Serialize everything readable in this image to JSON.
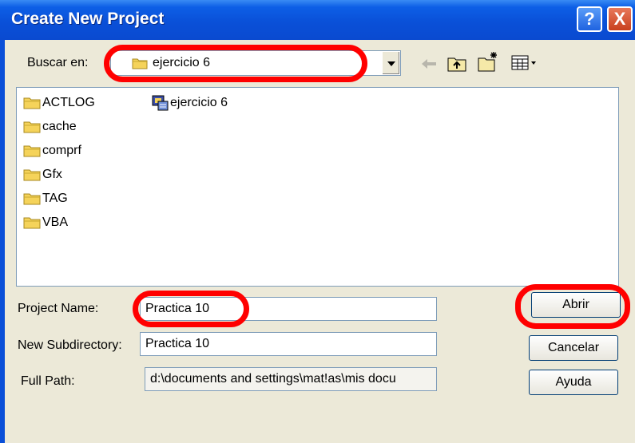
{
  "dialog": {
    "title": "Create New Project",
    "help_glyph": "?",
    "close_glyph": "X"
  },
  "lookin": {
    "label": "Buscar en:",
    "value": "ejercicio 6"
  },
  "toolbar_icons": [
    "back-arrow-icon",
    "up-folder-icon",
    "new-folder-icon",
    "view-menu-icon"
  ],
  "files": [
    {
      "name": "ACTLOG",
      "icon": "folder-icon"
    },
    {
      "name": "cache",
      "icon": "folder-icon"
    },
    {
      "name": "comprf",
      "icon": "folder-icon"
    },
    {
      "name": "Gfx",
      "icon": "folder-icon"
    },
    {
      "name": "TAG",
      "icon": "folder-icon"
    },
    {
      "name": "VBA",
      "icon": "folder-icon"
    },
    {
      "name": "ejercicio 6",
      "icon": "project-file-icon"
    }
  ],
  "form": {
    "project_name_label": "Project Name:",
    "project_name_value": "Practica 10",
    "subdir_label": "New Subdirectory:",
    "subdir_value": "Practica 10",
    "fullpath_label": "Full Path:",
    "fullpath_value": "d:\\documents and settings\\mat!as\\mis docu"
  },
  "buttons": {
    "open": "Abrir",
    "cancel": "Cancelar",
    "help": "Ayuda"
  },
  "colors": {
    "title_bar": "#0a50d8",
    "dialog_bg": "#ece9d8",
    "annotation_ring": "#ff0000",
    "folder_yellow": "#f5d35a"
  }
}
